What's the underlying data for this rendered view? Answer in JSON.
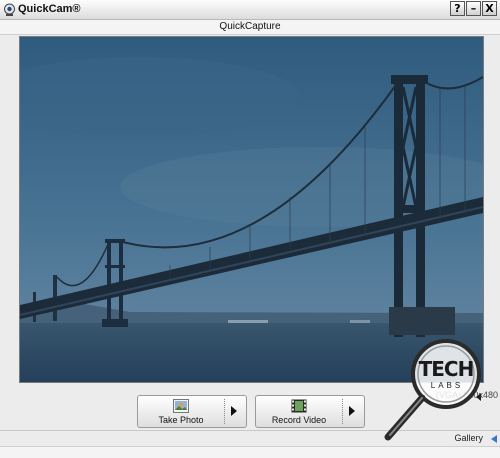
{
  "window": {
    "title": "QuickCam®",
    "help": "?",
    "minimize": "–",
    "close": "X"
  },
  "header": {
    "title": "QuickCapture"
  },
  "controls": {
    "take_photo": {
      "label": "Take Photo",
      "icon": "photo-icon"
    },
    "record_video": {
      "label": "Record Video",
      "icon": "film-icon"
    },
    "resolution": "(VGA) 640x480"
  },
  "status": {
    "gallery": "Gallery"
  },
  "watermark": {
    "line1": "TECH",
    "line2": "LABS"
  },
  "colors": {
    "sky": "#3f6a8c",
    "water": "#2f4f68",
    "accent": "#3a79c9"
  }
}
